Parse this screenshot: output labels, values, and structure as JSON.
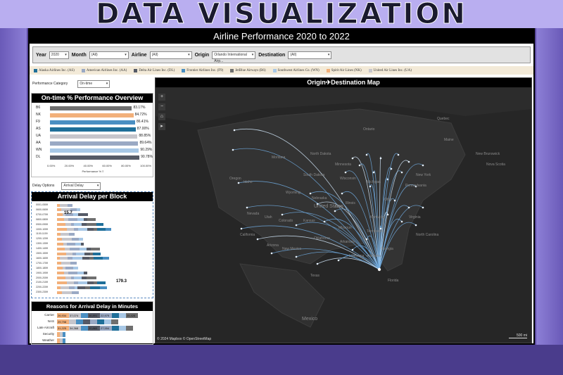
{
  "banner": "DATA VISUALIZATION",
  "title": "Airline Performance 2020 to 2022",
  "filters": {
    "year_label": "Year",
    "year_value": "2020",
    "month_label": "Month",
    "month_value": "(All)",
    "airline_label": "Airline",
    "airline_value": "(All)",
    "origin_label": "Origin",
    "origin_value": "Orlando International Airp...",
    "destination_label": "Destination",
    "destination_value": "(All)"
  },
  "legend": [
    {
      "label": "Alaska Airlines Inc. (AS)",
      "color": "#1f6f99"
    },
    {
      "label": "American Airlines Inc. (AA)",
      "color": "#9aa9c4"
    },
    {
      "label": "Delta Air Lines Inc. (DL)",
      "color": "#555a66"
    },
    {
      "label": "Frontier Airlines Inc. (F9)",
      "color": "#4a8fc2"
    },
    {
      "label": "JetBlue Airways (B6)",
      "color": "#6f6f6f"
    },
    {
      "label": "Southwest Airlines Co. (WN)",
      "color": "#a8c8e6"
    },
    {
      "label": "Spirit Air Lines (NK)",
      "color": "#f2b07a"
    },
    {
      "label": "United Air Lines Inc. (UA)",
      "color": "#c6c6cc"
    }
  ],
  "performance_category": {
    "label": "Performance Category",
    "value": "On-time"
  },
  "ontime": {
    "title": "On-time % Performance Overview",
    "rows": [
      {
        "code": "B6",
        "value": 83.17,
        "label": "83.17%",
        "color": "#6f6f6f"
      },
      {
        "code": "NK",
        "value": 84.72,
        "label": "84.72%",
        "color": "#f2b07a"
      },
      {
        "code": "F9",
        "value": 86.41,
        "label": "86.41%",
        "color": "#4a8fc2"
      },
      {
        "code": "AS",
        "value": 87.0,
        "label": "87.00%",
        "color": "#1f6f99"
      },
      {
        "code": "UA",
        "value": 88.85,
        "label": "88.85%",
        "color": "#c6c6cc"
      },
      {
        "code": "AA",
        "value": 89.64,
        "label": "89.64%",
        "color": "#9aa9c4"
      },
      {
        "code": "WN",
        "value": 90.29,
        "label": "90.29%",
        "color": "#a8c8e6"
      },
      {
        "code": "DL",
        "value": 90.78,
        "label": "90.78%",
        "color": "#555a66"
      }
    ],
    "ticks": [
      "0.00%",
      "20.00%",
      "40.00%",
      "60.00%",
      "80.00%",
      "100.00%"
    ],
    "axis_label": "Performance % ≡"
  },
  "delay_options": {
    "label": "Delay Options",
    "value": "Arrival Delay"
  },
  "delay_block": {
    "title": "Arrival Delay per Block",
    "blocks": [
      "0001-0559",
      "0600-0659",
      "0700-0759",
      "0800-0859",
      "0900-0959",
      "1000-1059",
      "1100-1159",
      "1200-1259",
      "1300-1359",
      "1400-1459",
      "1500-1559",
      "1600-1659",
      "1700-1759",
      "1800-1859",
      "1900-1959",
      "2000-2059",
      "2100-2159",
      "2200-2259",
      "2300-2359"
    ],
    "min_label": "15.7",
    "max_label": "179.3"
  },
  "reasons": {
    "title": "Reasons for Arrival Delay in Minutes",
    "rows": [
      {
        "label": "Carrier",
        "segs": [
          "26,934",
          "37,074",
          "",
          "36,891",
          "22,979",
          "",
          "",
          "25,426"
        ]
      },
      {
        "label": "NAS",
        "segs": [
          "29,798",
          "",
          "",
          "",
          "",
          "",
          "",
          ""
        ]
      },
      {
        "label": "Late Aircraft",
        "segs": [
          "31,225",
          "34,368",
          "",
          "20,883",
          "27,554",
          "",
          "",
          ""
        ]
      },
      {
        "label": "Security",
        "segs": [
          "",
          "",
          "",
          "",
          "",
          "",
          "",
          ""
        ]
      },
      {
        "label": "Weather",
        "segs": [
          "",
          "",
          "",
          "",
          "",
          "",
          "",
          ""
        ]
      }
    ]
  },
  "map": {
    "title": "Origin✈Destination Map",
    "attribution": "© 2024 Mapbox  © OpenStreetMap",
    "scale": "500 mi",
    "labels": [
      "Montana",
      "North Dakota",
      "Minnesota",
      "South Dakota",
      "Oregon",
      "Idaho",
      "Wyoming",
      "Nebraska",
      "Nevada",
      "Utah",
      "Colorado",
      "Kansas",
      "United States",
      "California",
      "Arizona",
      "New Mexico",
      "Oklahoma",
      "Texas",
      "Mexico",
      "Ontario",
      "Quebec",
      "New Brunswick",
      "Nova Scotia",
      "Wisconsin",
      "Michigan",
      "Iowa",
      "Illinois",
      "Missouri",
      "Arkansas",
      "Tennessee",
      "Georgia",
      "Alabama",
      "Louisiana",
      "Kentucky",
      "Ohio",
      "Pennsylvania",
      "New York",
      "Maine",
      "Virginia",
      "North Carolina",
      "Florida"
    ],
    "controls": [
      "+",
      "−",
      "⌂",
      "▸"
    ]
  }
}
